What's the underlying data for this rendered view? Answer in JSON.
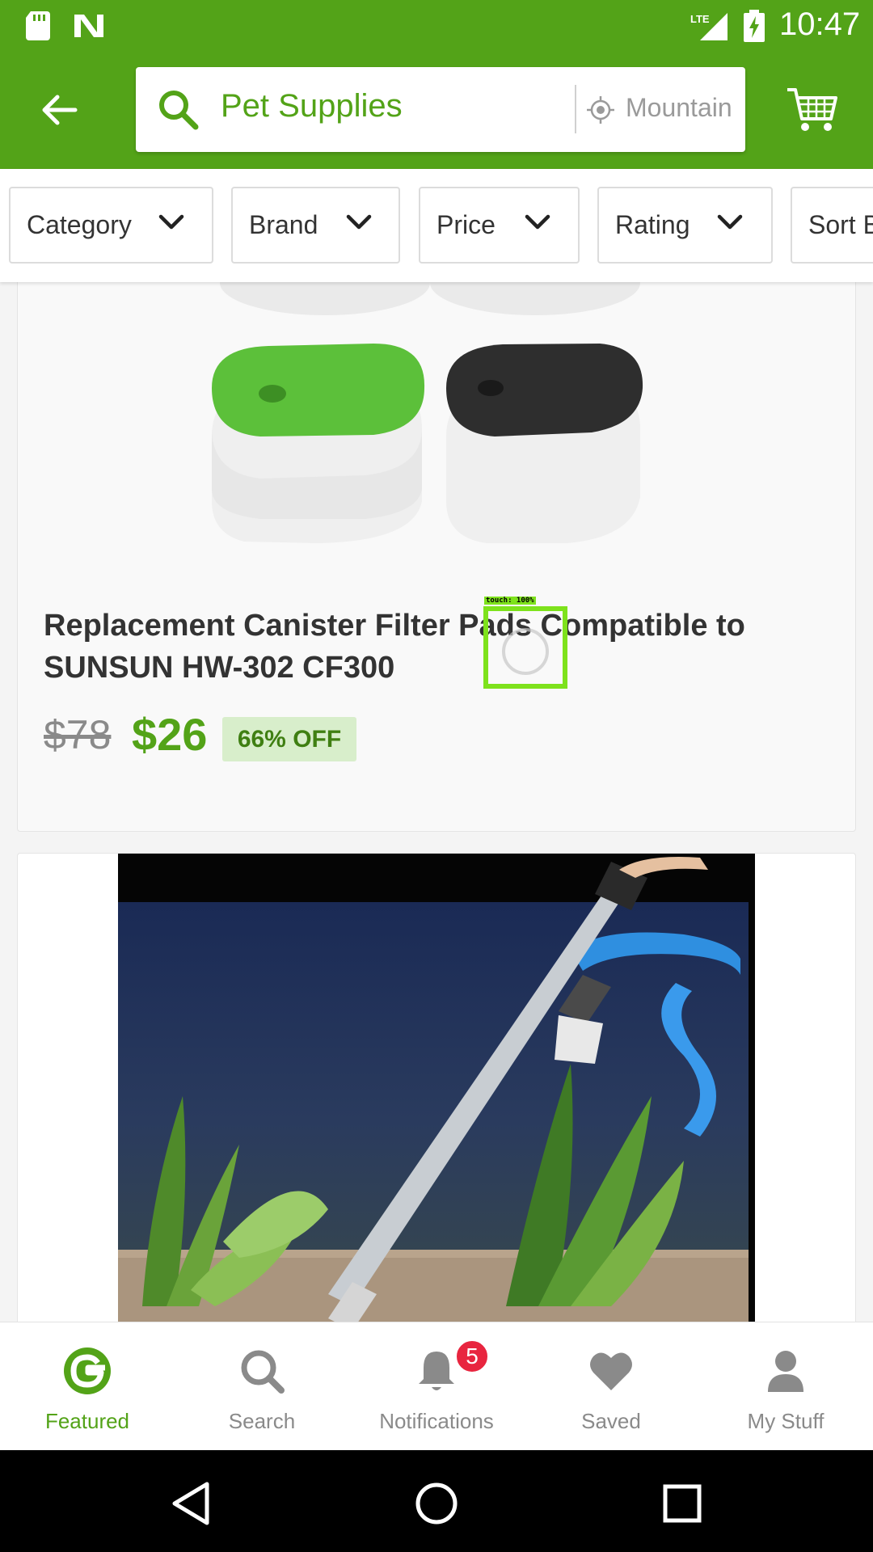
{
  "status_bar": {
    "time": "10:47",
    "icons": [
      "sd-card-icon",
      "n-logo-icon",
      "lte-signal-icon",
      "battery-charging-icon"
    ],
    "network": "LTE"
  },
  "app_bar": {
    "search_query": "Pet Supplies",
    "location": "Mountain",
    "icons": [
      "back-arrow-icon",
      "search-icon",
      "location-icon",
      "cart-icon"
    ]
  },
  "filters": [
    {
      "label": "Category"
    },
    {
      "label": "Brand"
    },
    {
      "label": "Price"
    },
    {
      "label": "Rating"
    },
    {
      "label": "Sort By"
    }
  ],
  "products": [
    {
      "title": "Replacement Canister Filter Pads Compatible to SUNSUN HW-302 CF300",
      "old_price": "$78",
      "new_price": "$26",
      "discount": "66% OFF"
    }
  ],
  "touch_indicator": {
    "label": "touch: 100%"
  },
  "bottom_nav": [
    {
      "label": "Featured",
      "icon": "groupon-g-icon",
      "active": true
    },
    {
      "label": "Search",
      "icon": "search-icon",
      "active": false
    },
    {
      "label": "Notifications",
      "icon": "bell-icon",
      "active": false,
      "badge": "5"
    },
    {
      "label": "Saved",
      "icon": "heart-icon",
      "active": false
    },
    {
      "label": "My Stuff",
      "icon": "person-icon",
      "active": false
    }
  ],
  "colors": {
    "brand_green": "#53a318",
    "badge_red": "#e8253f",
    "discount_bg": "#d8eecb",
    "touch_overlay": "#7ee21c"
  }
}
